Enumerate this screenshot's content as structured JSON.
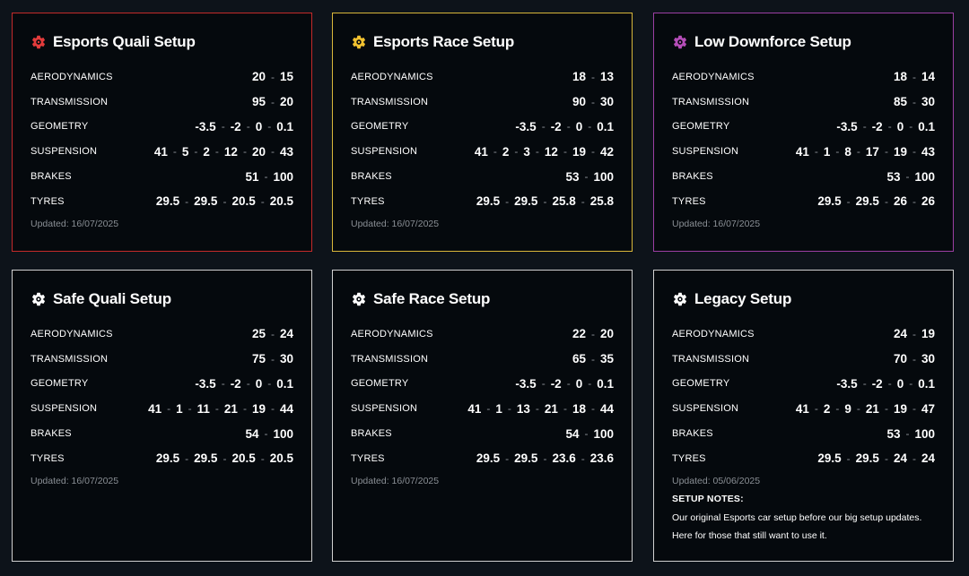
{
  "labels": {
    "aero": "AERODYNAMICS",
    "trans": "TRANSMISSION",
    "geo": "GEOMETRY",
    "susp": "SUSPENSION",
    "brakes": "BRAKES",
    "tyres": "TYRES"
  },
  "cards": [
    {
      "title": "Esports Quali Setup",
      "icon": "gear-icon",
      "border_color": "#c42a2a",
      "icon_color": "#e33b3b",
      "aero": [
        "20",
        "15"
      ],
      "trans": [
        "95",
        "20"
      ],
      "geo": [
        "-3.5",
        "-2",
        "0",
        "0.1"
      ],
      "susp": [
        "41",
        "5",
        "2",
        "12",
        "20",
        "43"
      ],
      "brakes": [
        "51",
        "100"
      ],
      "tyres": [
        "29.5",
        "29.5",
        "20.5",
        "20.5"
      ],
      "updated": "Updated: 16/07/2025"
    },
    {
      "title": "Esports Race Setup",
      "icon": "gear-icon",
      "border_color": "#d8b63a",
      "icon_color": "#f2c230",
      "aero": [
        "18",
        "13"
      ],
      "trans": [
        "90",
        "30"
      ],
      "geo": [
        "-3.5",
        "-2",
        "0",
        "0.1"
      ],
      "susp": [
        "41",
        "2",
        "3",
        "12",
        "19",
        "42"
      ],
      "brakes": [
        "53",
        "100"
      ],
      "tyres": [
        "29.5",
        "29.5",
        "25.8",
        "25.8"
      ],
      "updated": "Updated: 16/07/2025"
    },
    {
      "title": "Low Downforce Setup",
      "icon": "gear-icon",
      "border_color": "#9b3fa3",
      "icon_color": "#b54db8",
      "aero": [
        "18",
        "14"
      ],
      "trans": [
        "85",
        "30"
      ],
      "geo": [
        "-3.5",
        "-2",
        "0",
        "0.1"
      ],
      "susp": [
        "41",
        "1",
        "8",
        "17",
        "19",
        "43"
      ],
      "brakes": [
        "53",
        "100"
      ],
      "tyres": [
        "29.5",
        "29.5",
        "26",
        "26"
      ],
      "updated": "Updated: 16/07/2025"
    },
    {
      "title": "Safe Quali Setup",
      "icon": "gear-icon",
      "border_color": "#d0d0d0",
      "icon_color": "#ffffff",
      "aero": [
        "25",
        "24"
      ],
      "trans": [
        "75",
        "30"
      ],
      "geo": [
        "-3.5",
        "-2",
        "0",
        "0.1"
      ],
      "susp": [
        "41",
        "1",
        "11",
        "21",
        "19",
        "44"
      ],
      "brakes": [
        "54",
        "100"
      ],
      "tyres": [
        "29.5",
        "29.5",
        "20.5",
        "20.5"
      ],
      "updated": "Updated: 16/07/2025"
    },
    {
      "title": "Safe Race Setup",
      "icon": "gear-icon",
      "border_color": "#d0d0d0",
      "icon_color": "#ffffff",
      "aero": [
        "22",
        "20"
      ],
      "trans": [
        "65",
        "35"
      ],
      "geo": [
        "-3.5",
        "-2",
        "0",
        "0.1"
      ],
      "susp": [
        "41",
        "1",
        "13",
        "21",
        "18",
        "44"
      ],
      "brakes": [
        "54",
        "100"
      ],
      "tyres": [
        "29.5",
        "29.5",
        "23.6",
        "23.6"
      ],
      "updated": "Updated: 16/07/2025"
    },
    {
      "title": "Legacy Setup",
      "icon": "gear-icon",
      "border_color": "#d0d0d0",
      "icon_color": "#ffffff",
      "aero": [
        "24",
        "19"
      ],
      "trans": [
        "70",
        "30"
      ],
      "geo": [
        "-3.5",
        "-2",
        "0",
        "0.1"
      ],
      "susp": [
        "41",
        "2",
        "9",
        "21",
        "19",
        "47"
      ],
      "brakes": [
        "53",
        "100"
      ],
      "tyres": [
        "29.5",
        "29.5",
        "24",
        "24"
      ],
      "updated": "Updated: 05/06/2025",
      "notes_title": "SETUP NOTES:",
      "notes_text": "Our original Esports car setup before our big setup updates. Here for those that still want to use it."
    }
  ]
}
